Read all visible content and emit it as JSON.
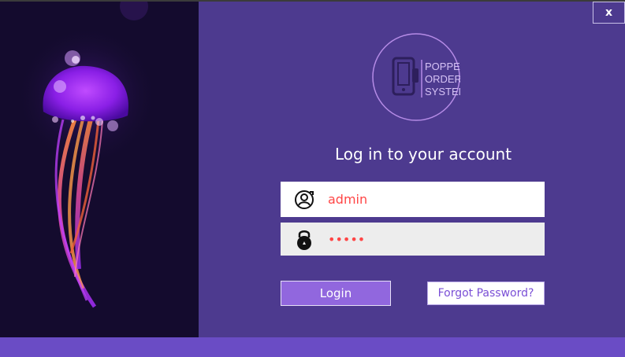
{
  "window": {
    "close_label": "x"
  },
  "logo": {
    "line1": "POPPEL",
    "line2": "ORDERING",
    "line3": "SYSTEM",
    "icon": "smartphone-icon"
  },
  "login": {
    "title": "Log in to your account",
    "username_value": "admin",
    "username_icon": "user-refresh-icon",
    "password_value": "•••••",
    "password_icon": "lock-icon",
    "login_label": "Login",
    "forgot_label": "Forgot Password?"
  },
  "colors": {
    "left_panel": "#140b2e",
    "right_panel": "#4d3a8f",
    "bottom_bar": "#6a4cc5",
    "accent": "#9167de",
    "input_text": "#ff4646",
    "logo_stroke": "#b58be6"
  }
}
